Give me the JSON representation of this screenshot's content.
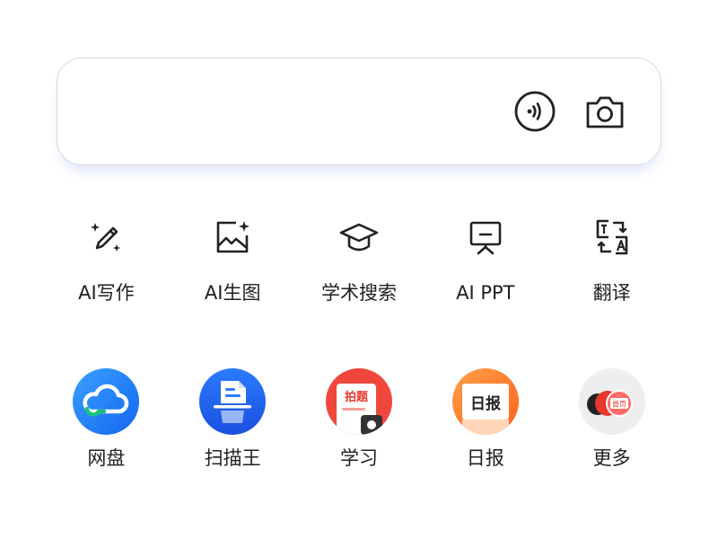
{
  "search": {
    "voice_icon": "voice-wave-icon",
    "camera_icon": "camera-icon"
  },
  "tools": [
    {
      "label": "AI写作",
      "icon": "magic-pen-icon"
    },
    {
      "label": "AI生图",
      "icon": "image-sparkle-icon"
    },
    {
      "label": "学术搜索",
      "icon": "graduation-cap-icon"
    },
    {
      "label": "AI PPT",
      "icon": "presentation-board-icon"
    },
    {
      "label": "翻译",
      "icon": "translate-icon"
    }
  ],
  "apps": [
    {
      "label": "网盘",
      "icon": "cloud-drive-icon"
    },
    {
      "label": "扫描王",
      "icon": "scanner-icon"
    },
    {
      "label": "学习",
      "icon": "study-icon",
      "badge": "拍题"
    },
    {
      "label": "日报",
      "icon": "daily-report-icon",
      "badge": "日报"
    },
    {
      "label": "更多",
      "icon": "more-apps-icon",
      "badge": "首页"
    }
  ],
  "colors": {
    "text": "#1f1f1f",
    "icon_stroke": "#222222",
    "box_border": "#d6d9e0",
    "netdisk_blue": "#1677ff",
    "netdisk_green": "#19c37d",
    "scanner_blue": "#2f6bff",
    "study_red": "#f0473c",
    "daily_orange": "#ff7a22"
  }
}
